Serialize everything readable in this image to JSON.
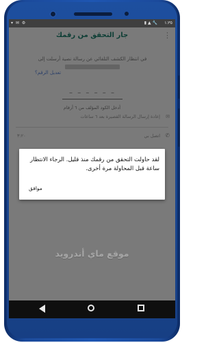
{
  "statusbar": {
    "time": "١:٣٥",
    "left_icons": "▾ ✉ ⚙",
    "right_icons": "▮ ▲ 🔧"
  },
  "header": {
    "title": "جار التحقق من رقمك",
    "menu_icon": "more-vert-icon"
  },
  "verification": {
    "description": "في انتظار الكشف التلقائي عن رسالة نصية أرسلت إلى",
    "edit_link": "تعديل الرقم؟",
    "code_placeholder": "– – –   – – –",
    "code_hint": "أدخل الكود المؤلف من ٦ أرقام",
    "resend_sms": "إعادة إرسال الرسالة القصيرة بعد ٦ ساعات",
    "call_label": "اتصل بي",
    "call_timer": "٣:٢٠"
  },
  "dialog": {
    "message": "لقد حاولت التحقق من رقمك منذ قليل. الرجاء الانتظار ساعة قبل المحاولة مرة أخرى.",
    "ok_button": "موافق"
  },
  "watermark": "موقع ماي أندرويد",
  "colors": {
    "phone_frame": "#1e56b2",
    "overlay": "#7a7a7a",
    "title": "#0d3e35",
    "dialog_bg": "#ffffff"
  }
}
